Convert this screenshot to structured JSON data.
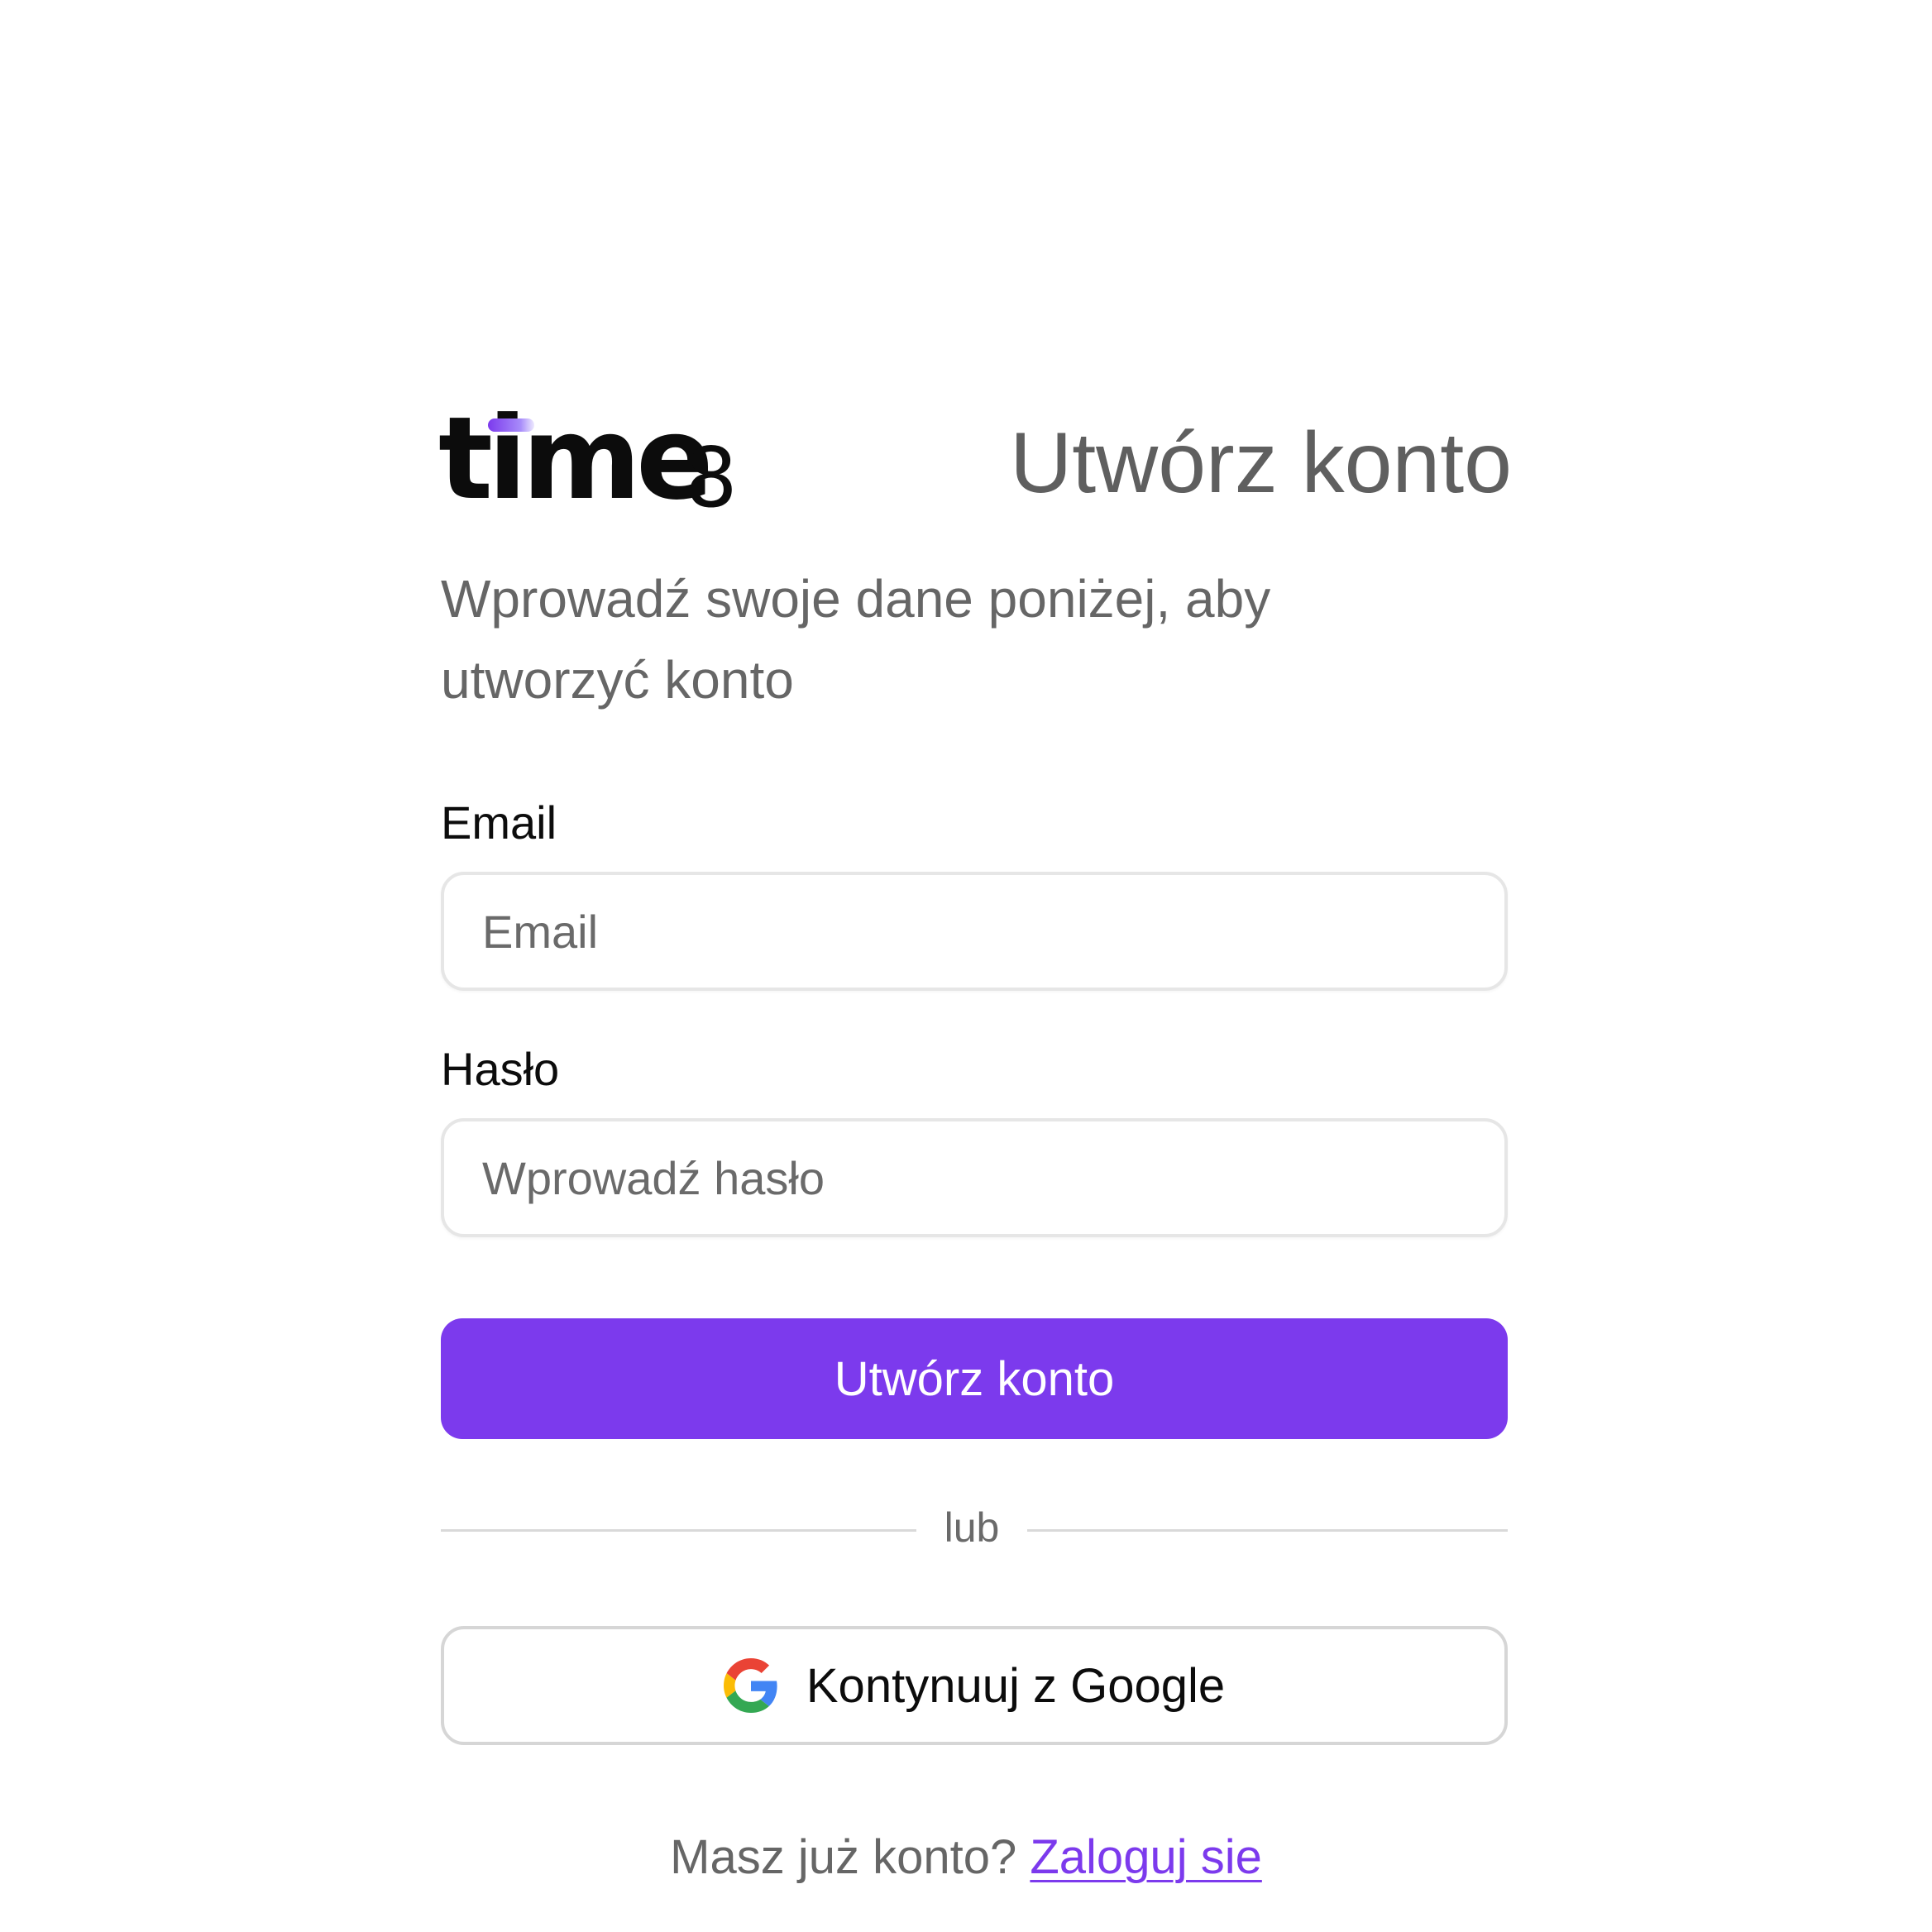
{
  "brand": {
    "logo_text": "time",
    "logo_suffix": "8",
    "accent_color": "#7c3aed"
  },
  "header": {
    "title": "Utwórz konto"
  },
  "intro": {
    "subtitle": "Wprowadź swoje dane poniżej, aby utworzyć konto"
  },
  "form": {
    "email": {
      "label": "Email",
      "placeholder": "Email",
      "value": ""
    },
    "password": {
      "label": "Hasło",
      "placeholder": "Wprowadź hasło",
      "value": ""
    },
    "submit_label": "Utwórz konto"
  },
  "divider": {
    "text": "lub"
  },
  "google": {
    "label": "Kontynuuj z Google",
    "icon": "google-g-icon"
  },
  "footer": {
    "prompt": "Masz już konto?",
    "link_label": "Zaloguj sie"
  }
}
